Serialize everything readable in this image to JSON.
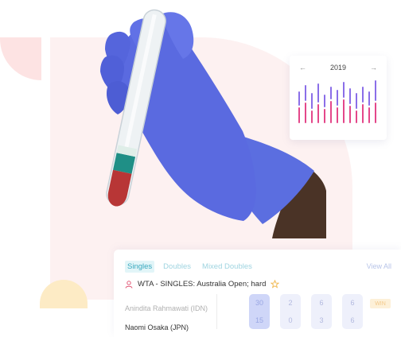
{
  "chart_card": {
    "year": "2019",
    "prev_icon": "arrow-left-icon",
    "next_icon": "arrow-right-icon",
    "prev_glyph": "←",
    "next_glyph": "→"
  },
  "score_card": {
    "tabs": [
      {
        "label": "Singles",
        "active": true
      },
      {
        "label": "Doubles",
        "active": false
      },
      {
        "label": "Mixed Doubles",
        "active": false
      }
    ],
    "view_all": "View All",
    "tournament": "WTA - SINGLES: Australia Open; hard",
    "players": [
      {
        "name": "Anindita Rahmawati (IDN)"
      },
      {
        "name": "Naomi Osaka (JPN)"
      }
    ],
    "sets": [
      {
        "top": "30",
        "bottom": "15"
      },
      {
        "top": "2",
        "bottom": "0"
      },
      {
        "top": "6",
        "bottom": "3"
      },
      {
        "top": "6",
        "bottom": "6"
      }
    ],
    "winner_badge": "WIN"
  },
  "colors": {
    "accent_teal": "#3aa9bf",
    "bar_pink": "#e4478a",
    "bar_purple": "#8a6ee8"
  }
}
